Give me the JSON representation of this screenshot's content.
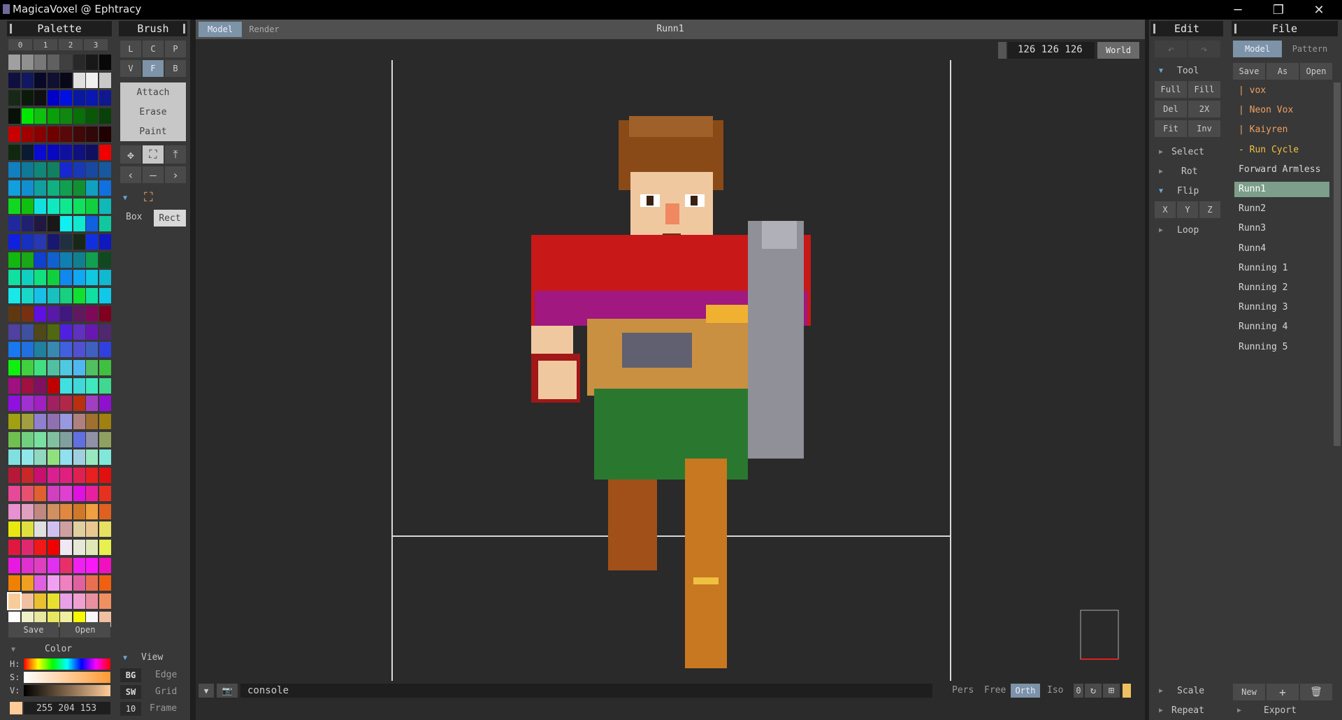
{
  "window": {
    "title": "MagicaVoxel @ Ephtracy",
    "minimize": "─",
    "maximize": "❐",
    "close": "✕"
  },
  "palette": {
    "title": "Palette",
    "tabs": [
      "0",
      "1",
      "2",
      "3"
    ],
    "save": "Save",
    "open": "Open",
    "colors": [
      [
        "#a0a0a0",
        "#909090",
        "#787878",
        "#606060",
        "#404040",
        "#282828",
        "#181818",
        "#080808"
      ],
      [
        "#101040",
        "#101860",
        "#080828",
        "#101030",
        "#080818",
        "#e0e0e0",
        "#f0f0f0",
        "#c8c8c8"
      ],
      [
        "#182818",
        "#0c1a0c",
        "#101010",
        "#0000c8",
        "#0010e0",
        "#0818a0",
        "#0818b0",
        "#101890"
      ],
      [
        "#081008",
        "#00e800",
        "#10c010",
        "#08a008",
        "#108810",
        "#087008",
        "#085808",
        "#0a400a"
      ],
      [
        "#c80000",
        "#a00000",
        "#880000",
        "#700000",
        "#580808",
        "#400808",
        "#300808",
        "#200000"
      ],
      [
        "#102810",
        "#0a1a30",
        "#0a0ad0",
        "#0808c0",
        "#1010a0",
        "#101080",
        "#101060",
        "#f00000"
      ],
      [
        "#1080c0",
        "#107898",
        "#108878",
        "#108060",
        "#1828d0",
        "#1838b8",
        "#1848a0",
        "#1858a0"
      ],
      [
        "#10a0e0",
        "#1090d0",
        "#10a0a0",
        "#10b080",
        "#10a050",
        "#109030",
        "#10a0c0",
        "#1070e0"
      ],
      [
        "#10d820",
        "#10c010",
        "#10e0e0",
        "#10e8c0",
        "#10e890",
        "#10e060",
        "#10d040",
        "#10b8b8"
      ],
      [
        "#2028a0",
        "#202070",
        "#201840",
        "#181818",
        "#10f0f0",
        "#10e8d0",
        "#1060e0",
        "#10c8a0"
      ],
      [
        "#1020e0",
        "#1830c0",
        "#2838b0",
        "#181870",
        "#203040",
        "#182818",
        "#1030e0",
        "#1018c0"
      ],
      [
        "#10b810",
        "#18a818",
        "#1040d0",
        "#1060d0",
        "#1080b0",
        "#108090",
        "#10a050",
        "#104820"
      ],
      [
        "#10e0a0",
        "#10d0c0",
        "#10e080",
        "#10d040",
        "#1088f0",
        "#10a8f0",
        "#10c8e0",
        "#10b8d0"
      ],
      [
        "#18e8e8",
        "#18d8c8",
        "#18c0e8",
        "#18c0c0",
        "#18d080",
        "#10e030",
        "#10e0a0",
        "#10c8e8"
      ],
      [
        "#603810",
        "#783010",
        "#6010e0",
        "#5818a8",
        "#401880",
        "#601860",
        "#800858",
        "#800020"
      ],
      [
        "#5040a0",
        "#4050a0",
        "#504818",
        "#506810",
        "#5020e0",
        "#6030c0",
        "#6818b0",
        "#502870"
      ],
      [
        "#1878f0",
        "#2070e0",
        "#2080a0",
        "#3888b0",
        "#4060e0",
        "#5050d0",
        "#4060c0",
        "#3040e0"
      ],
      [
        "#10f010",
        "#40d040",
        "#40e080",
        "#50c0a0",
        "#50c8e0",
        "#50b8f0",
        "#50c060",
        "#40c040"
      ],
      [
        "#a01080",
        "#a01040",
        "#801060",
        "#c00000",
        "#40e0e0",
        "#40d8d8",
        "#40e8c0",
        "#40d890"
      ],
      [
        "#9010e0",
        "#a030d0",
        "#a020c0",
        "#a02060",
        "#b02848",
        "#b83010",
        "#a040c0",
        "#9010d0"
      ],
      [
        "#a0a010",
        "#a0a040",
        "#9080d0",
        "#9070b0",
        "#9898e0",
        "#b08080",
        "#a07030",
        "#a08010"
      ],
      [
        "#70c050",
        "#70d080",
        "#78e0a0",
        "#80c0a0",
        "#80a0a0",
        "#6070e0",
        "#9090a8",
        "#90a060"
      ],
      [
        "#80e0e0",
        "#90e8e8",
        "#90d8c0",
        "#90e080",
        "#90e0f0",
        "#a0d0e0",
        "#98e8c0",
        "#80e8d8"
      ],
      [
        "#b81838",
        "#c82828",
        "#c81070",
        "#d82090",
        "#e02080",
        "#e02050",
        "#e82020",
        "#e01010"
      ],
      [
        "#e84898",
        "#e85070",
        "#e06030",
        "#d040c0",
        "#e040d0",
        "#e010e0",
        "#e820a0",
        "#e83020"
      ],
      [
        "#e890d0",
        "#e0a0c0",
        "#c08880",
        "#d09060",
        "#e08840",
        "#d07828",
        "#f0a040",
        "#e06020"
      ],
      [
        "#e8e810",
        "#e0e040",
        "#e0e0e0",
        "#d0c0f0",
        "#d0a0a0",
        "#e0d0a0",
        "#e8c890",
        "#e8e060"
      ],
      [
        "#e01840",
        "#e02870",
        "#f01818",
        "#f00000",
        "#f0e8f0",
        "#e8e8d8",
        "#e0e8b8",
        "#e8f050"
      ],
      [
        "#e818e0",
        "#e030d0",
        "#e040c0",
        "#e030f0",
        "#e83068",
        "#f020f0",
        "#f818f8",
        "#f010c0"
      ],
      [
        "#f08000",
        "#f0a020",
        "#e060e0",
        "#f0a0f0",
        "#f080c0",
        "#e060a0",
        "#e87050",
        "#f06010"
      ],
      [
        "#f8cc99",
        "#f0c0a0",
        "#e8c030",
        "#e8e030",
        "#e8a0e8",
        "#f0a0d0",
        "#e890a0",
        "#f09060"
      ],
      [
        "#ffffff",
        "#f0f0c8",
        "#e8e8a0",
        "#e8e860",
        "#f0f0a0",
        "#f8f800",
        "#f8f8f8",
        "#f0c0a0"
      ]
    ]
  },
  "color": {
    "label": "Color",
    "h": "H:",
    "s": "S:",
    "v": "V:",
    "value": "255 204 153",
    "swatch": "#ffcc99"
  },
  "brush": {
    "title": "Brush",
    "modes_row1": [
      "L",
      "C",
      "P"
    ],
    "modes_row2": [
      "V",
      "F",
      "B"
    ],
    "active_mode": "F",
    "actions": [
      "Attach",
      "Erase",
      "Paint"
    ],
    "box": "Box",
    "rect": "Rect"
  },
  "view": {
    "title": "View",
    "bg": "BG",
    "edge": "Edge",
    "sw": "SW",
    "grid": "Grid",
    "frame_num": "10",
    "frame": "Frame"
  },
  "viewport": {
    "tab_model": "Model",
    "tab_render": "Render",
    "model_name": "Runn1",
    "dims": "126 126 126",
    "world": "World",
    "console_placeholder": "console",
    "cam_pers": "Pers",
    "cam_free": "Free",
    "cam_orth": "Orth",
    "cam_iso": "Iso",
    "zero": "0"
  },
  "edit": {
    "title": "Edit",
    "tool": "Tool",
    "full": "Full",
    "fill": "Fill",
    "del": "Del",
    "twox": "2X",
    "fit": "Fit",
    "inv": "Inv",
    "select": "Select",
    "rot": "Rot",
    "flip": "Flip",
    "x": "X",
    "y": "Y",
    "z": "Z",
    "loop": "Loop",
    "scale": "Scale",
    "repeat": "Repeat"
  },
  "file": {
    "title": "File",
    "tab_model": "Model",
    "tab_pattern": "Pattern",
    "save": "Save",
    "as": "As",
    "open": "Open",
    "items": [
      {
        "label": "| vox",
        "style": "orange"
      },
      {
        "label": "| Neon Vox",
        "style": "orange"
      },
      {
        "label": "| Kaiyren",
        "style": "orange"
      },
      {
        "label": "- Run Cycle",
        "style": "yellow"
      },
      {
        "label": "Forward Armless",
        "style": ""
      },
      {
        "label": "Runn1",
        "style": "selected"
      },
      {
        "label": "Runn2",
        "style": ""
      },
      {
        "label": "Runn3",
        "style": ""
      },
      {
        "label": "Runn4",
        "style": ""
      },
      {
        "label": "Running 1",
        "style": ""
      },
      {
        "label": "Running 2",
        "style": ""
      },
      {
        "label": "Running 3",
        "style": ""
      },
      {
        "label": "Running 4",
        "style": ""
      },
      {
        "label": "Running 5",
        "style": ""
      }
    ],
    "new": "New",
    "add": "+",
    "export": "Export"
  }
}
